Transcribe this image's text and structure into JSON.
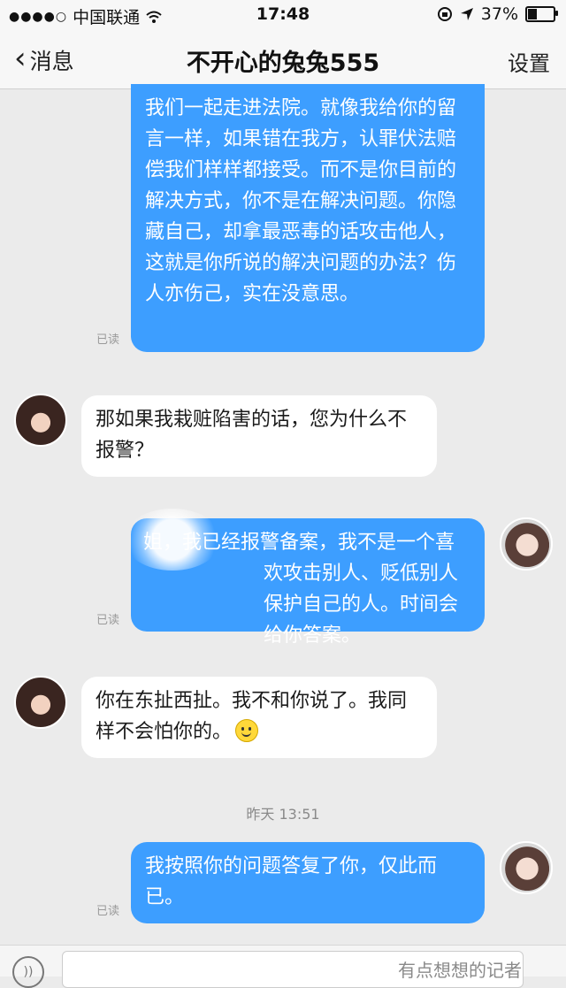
{
  "status_bar": {
    "carrier": "中国联通",
    "time": "17:48",
    "battery": "37%",
    "battery_level": 0.37
  },
  "nav": {
    "back_label": "消息",
    "title": "不开心的兔兔555",
    "settings_label": "设置"
  },
  "messages": [
    {
      "direction": "out",
      "text": "我们一起走进法院。就像我给你的留言一样，如果错在我方，认罪伏法赔偿我们样样都接受。而不是你目前的解决方式，你不是在解决问题。你隐藏自己，却拿最恶毒的话攻击他人，这就是你所说的解决问题的办法？伤人亦伤己，实在没意思。",
      "read": "已读"
    },
    {
      "direction": "in",
      "text": "那如果我栽赃陷害的话，您为什么不报警？"
    },
    {
      "direction": "out",
      "text": "姐，我已经报警备案，我不是一个喜欢攻击别人、贬低别人保护自己的人。时间会给你答案。",
      "read": "已读"
    },
    {
      "direction": "in",
      "text": "你在东扯西扯。我不和你说了。我同样不会怕你的。"
    },
    {
      "direction": "out",
      "text": "我按照你的问题答复了你，仅此而已。",
      "read": "已读"
    }
  ],
  "time_divider": "昨天 13:51",
  "watermark": "有点想想的记者",
  "icons": {
    "back": "chevron-left-icon",
    "voice": "voice-icon",
    "emoji": "smiley-icon",
    "wifi": "wifi-icon",
    "location": "location-arrow-icon",
    "battery": "battery-icon"
  }
}
